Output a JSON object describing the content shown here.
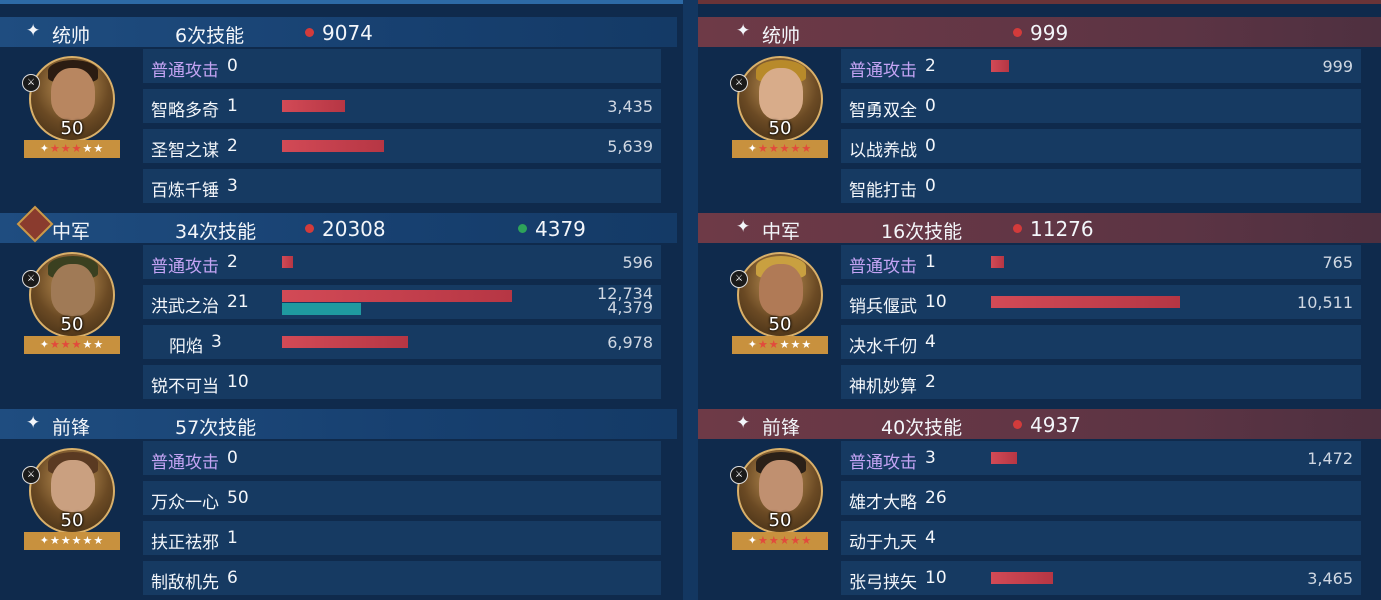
{
  "left": {
    "sections": [
      {
        "role": "统帅",
        "casts": "6次技能",
        "damage": "9074",
        "heal": "",
        "level": "50",
        "skills": [
          {
            "name": "普通攻击",
            "count": "0",
            "basic": true,
            "value": "",
            "bar": 0
          },
          {
            "name": "智略多奇",
            "count": "1",
            "basic": false,
            "value": "3,435",
            "bar": 0.276
          },
          {
            "name": "圣智之谋",
            "count": "2",
            "basic": false,
            "value": "5,639",
            "bar": 0.443
          },
          {
            "name": "百炼千锤",
            "count": "3",
            "basic": false,
            "value": "",
            "bar": 0
          }
        ]
      },
      {
        "role": "中军",
        "casts": "34次技能",
        "damage": "20308",
        "heal": "4379",
        "level": "50",
        "skills": [
          {
            "name": "普通攻击",
            "count": "2",
            "basic": true,
            "value": "596",
            "bar": 0.048
          },
          {
            "name": "洪武之治",
            "count": "21",
            "basic": false,
            "value": "12,734",
            "value2": "4,379",
            "bar": 1.0,
            "bar2": 0.344
          },
          {
            "name": "阳焰",
            "count": "3",
            "basic": false,
            "value": "6,978",
            "bar": 0.548
          },
          {
            "name": "锐不可当",
            "count": "10",
            "basic": false,
            "value": "",
            "bar": 0
          }
        ]
      },
      {
        "role": "前锋",
        "casts": "57次技能",
        "damage": "",
        "heal": "",
        "level": "50",
        "skills": [
          {
            "name": "普通攻击",
            "count": "0",
            "basic": true,
            "value": "",
            "bar": 0
          },
          {
            "name": "万众一心",
            "count": "50",
            "basic": false,
            "value": "",
            "bar": 0
          },
          {
            "name": "扶正祛邪",
            "count": "1",
            "basic": false,
            "value": "",
            "bar": 0
          },
          {
            "name": "制敌机先",
            "count": "6",
            "basic": false,
            "value": "",
            "bar": 0
          }
        ]
      }
    ]
  },
  "right": {
    "sections": [
      {
        "role": "统帅",
        "casts": "",
        "damage": "999",
        "level": "50",
        "skills": [
          {
            "name": "普通攻击",
            "count": "2",
            "basic": true,
            "value": "999",
            "bar": 0.095
          },
          {
            "name": "智勇双全",
            "count": "0",
            "basic": false,
            "value": "",
            "bar": 0
          },
          {
            "name": "以战养战",
            "count": "0",
            "basic": false,
            "value": "",
            "bar": 0
          },
          {
            "name": "智能打击",
            "count": "0",
            "basic": false,
            "value": "",
            "bar": 0
          }
        ]
      },
      {
        "role": "中军",
        "casts": "16次技能",
        "damage": "11276",
        "level": "50",
        "skills": [
          {
            "name": "普通攻击",
            "count": "1",
            "basic": true,
            "value": "765",
            "bar": 0.07
          },
          {
            "name": "销兵偃武",
            "count": "10",
            "basic": false,
            "value": "10,511",
            "bar": 1.0
          },
          {
            "name": "决水千仞",
            "count": "4",
            "basic": false,
            "value": "",
            "bar": 0
          },
          {
            "name": "神机妙算",
            "count": "2",
            "basic": false,
            "value": "",
            "bar": 0
          }
        ]
      },
      {
        "role": "前锋",
        "casts": "40次技能",
        "damage": "4937",
        "level": "50",
        "skills": [
          {
            "name": "普通攻击",
            "count": "3",
            "basic": true,
            "value": "1,472",
            "bar": 0.14
          },
          {
            "name": "雄才大略",
            "count": "26",
            "basic": false,
            "value": "",
            "bar": 0
          },
          {
            "name": "动于九天",
            "count": "4",
            "basic": false,
            "value": "",
            "bar": 0
          },
          {
            "name": "张弓挟矢",
            "count": "10",
            "basic": false,
            "value": "3,465",
            "bar": 0.33
          }
        ]
      }
    ]
  },
  "icons": {
    "header": "sparkle-icon",
    "shield": "shield-icon",
    "badge": "sword-icon"
  },
  "colors": {
    "damage_dot": "#d23b3b",
    "heal_dot": "#2ea35a",
    "damage_bar": "#c23e4b",
    "heal_bar": "#1f9aa0",
    "basic_attack_text": "#c4a4f4"
  }
}
